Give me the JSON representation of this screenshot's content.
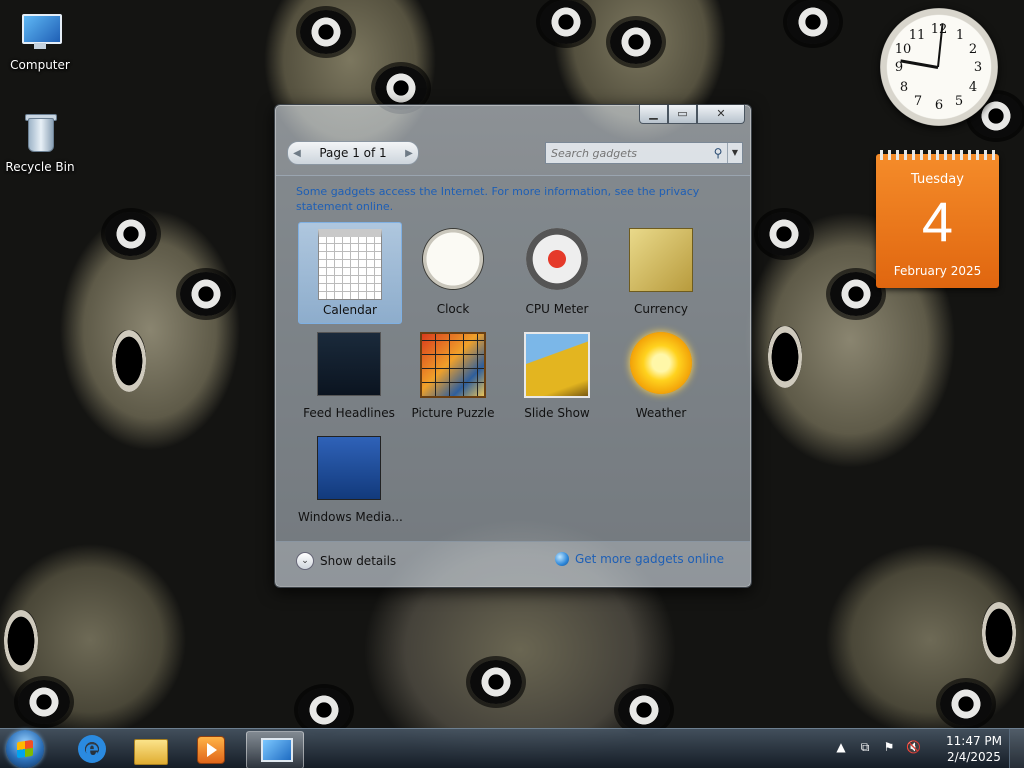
{
  "desktop": {
    "icons": [
      {
        "label": "Computer",
        "icon": "computer-icon"
      },
      {
        "label": "Recycle Bin",
        "icon": "recycle-bin-icon"
      }
    ]
  },
  "clock_gadget": {
    "numerals": [
      "12",
      "1",
      "2",
      "3",
      "4",
      "5",
      "6",
      "7",
      "8",
      "9",
      "10",
      "11"
    ]
  },
  "calendar_gadget": {
    "weekday": "Tuesday",
    "day": "4",
    "month_year": "February 2025"
  },
  "gallery": {
    "window_buttons": {
      "minimize": "▁",
      "maximize": "▭",
      "close": "✕"
    },
    "pager": {
      "prev": "◀",
      "label": "Page 1 of 1",
      "next": "▶"
    },
    "search": {
      "placeholder": "Search gadgets",
      "icon": "search-icon",
      "dropdown": "▼"
    },
    "notice": "Some gadgets access the Internet.  For more information, see the privacy statement online.",
    "gadgets": [
      {
        "label": "Calendar",
        "selected": true
      },
      {
        "label": "Clock",
        "selected": false
      },
      {
        "label": "CPU Meter",
        "selected": false
      },
      {
        "label": "Currency",
        "selected": false
      },
      {
        "label": "Feed Headlines",
        "selected": false
      },
      {
        "label": "Picture Puzzle",
        "selected": false
      },
      {
        "label": "Slide Show",
        "selected": false
      },
      {
        "label": "Weather",
        "selected": false
      },
      {
        "label": "Windows Media...",
        "selected": false
      }
    ],
    "footer": {
      "show_details": "Show details",
      "chevron": "⌄",
      "get_more": "Get more gadgets online"
    }
  },
  "taskbar": {
    "tray_icons": [
      "▲",
      "⧉",
      "⚑",
      "🔇"
    ],
    "time": "11:47 PM",
    "date": "2/4/2025"
  },
  "colors": {
    "calendar_orange": "#e97a1b",
    "link_blue": "#1e5fb5",
    "taskbar": "#1c2530"
  }
}
